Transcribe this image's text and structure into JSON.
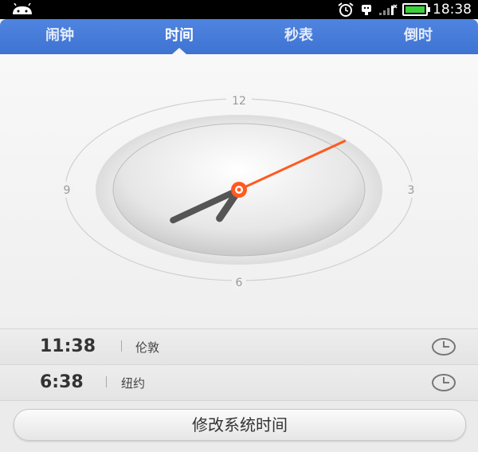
{
  "status_bar": {
    "time": "18:38"
  },
  "tabs": [
    {
      "label": "闹钟"
    },
    {
      "label": "时间"
    },
    {
      "label": "秒表"
    },
    {
      "label": "倒时"
    }
  ],
  "clock": {
    "numerals": {
      "top": "12",
      "right": "3",
      "bottom": "6",
      "left": "9"
    },
    "hands": {
      "hour": 18,
      "minute": 38,
      "second": 8
    },
    "colors": {
      "hand": "#555555",
      "second_hand": "#ff5a1f"
    }
  },
  "world_times": [
    {
      "time": "11:38",
      "city": "伦敦"
    },
    {
      "time": "6:38",
      "city": "纽约"
    }
  ],
  "actions": {
    "change_time": "修改系统时间"
  },
  "theme": {
    "accent": "#4a7ddc"
  }
}
